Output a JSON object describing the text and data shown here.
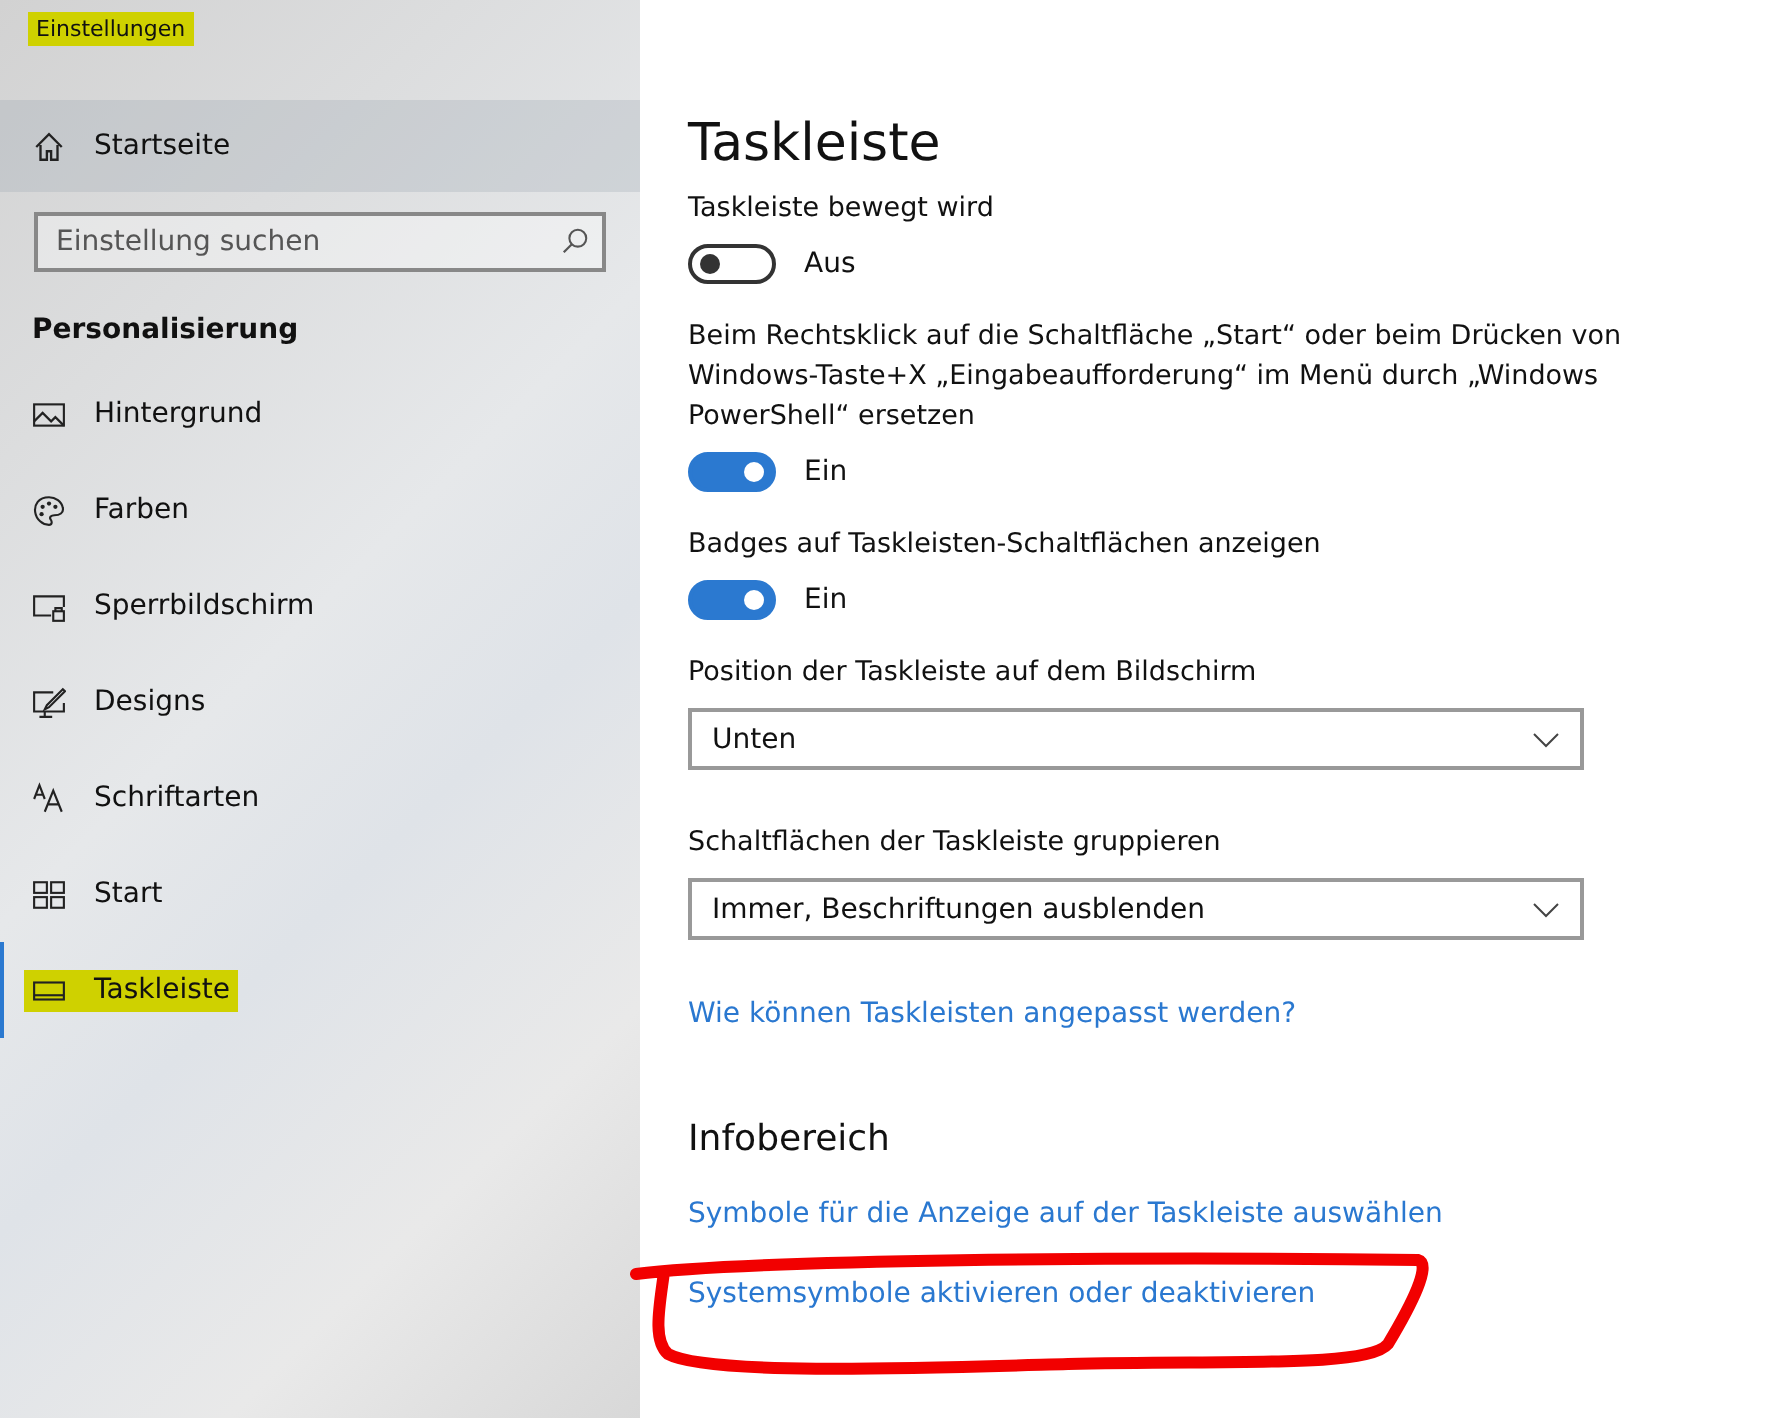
{
  "window": {
    "title": "Einstellungen",
    "highlighted": true
  },
  "sidebar": {
    "home": "Startseite",
    "search": {
      "placeholder": "Einstellung suchen"
    },
    "section": "Personalisierung",
    "items": [
      {
        "label": "Hintergrund",
        "selected": false,
        "highlighted": false
      },
      {
        "label": "Farben",
        "selected": false,
        "highlighted": false
      },
      {
        "label": "Sperrbildschirm",
        "selected": false,
        "highlighted": false
      },
      {
        "label": "Designs",
        "selected": false,
        "highlighted": false
      },
      {
        "label": "Schriftarten",
        "selected": false,
        "highlighted": false
      },
      {
        "label": "Start",
        "selected": false,
        "highlighted": false
      },
      {
        "label": "Taskleiste",
        "selected": true,
        "highlighted": true
      }
    ]
  },
  "page": {
    "title": "Taskleiste",
    "settings": [
      {
        "kind": "toggle",
        "label": "Taskleiste bewegt wird",
        "on": false,
        "state": "Aus"
      },
      {
        "kind": "toggle",
        "label": "Beim Rechtsklick auf die Schaltfläche „Start“ oder beim Drücken von Windows-Taste+X „Eingabeaufforderung“ im Menü durch „Windows PowerShell“ ersetzen",
        "on": true,
        "state": "Ein"
      },
      {
        "kind": "toggle",
        "label": "Badges auf Taskleisten-Schaltflächen anzeigen",
        "on": true,
        "state": "Ein"
      },
      {
        "kind": "dropdown",
        "label": "Position der Taskleiste auf dem Bildschirm",
        "value": "Unten"
      },
      {
        "kind": "dropdown",
        "label": "Schaltflächen der Taskleiste gruppieren",
        "value": "Immer, Beschriftungen ausblenden"
      },
      {
        "kind": "link",
        "label": "Wie können Taskleisten angepasst werden?"
      }
    ],
    "section": "Infobereich",
    "links": [
      {
        "label": "Symbole für die Anzeige auf der Taskleiste auswählen",
        "circled": false
      },
      {
        "label": "Systemsymbole aktivieren oder deaktivieren",
        "circled": true
      }
    ]
  }
}
